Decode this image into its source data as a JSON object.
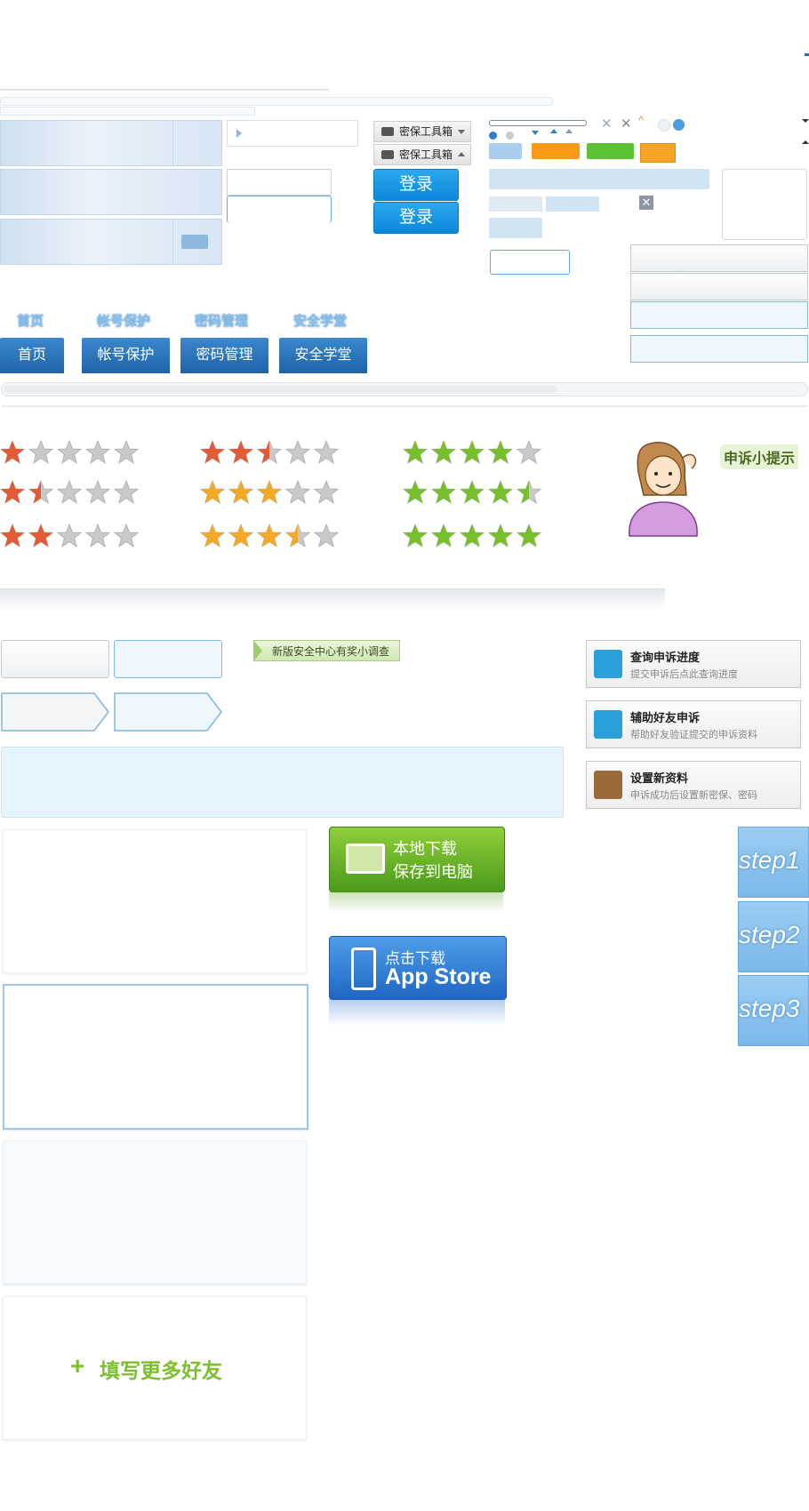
{
  "toolbox": {
    "label_a": "密保工具箱",
    "label_b": "密保工具箱"
  },
  "login": {
    "button_a": "登录",
    "button_b": "登录"
  },
  "nav": {
    "ghost": [
      "首页",
      "帐号保护",
      "密码管理",
      "安全学堂"
    ],
    "tabs": [
      "首页",
      "帐号保护",
      "密码管理",
      "安全学堂"
    ]
  },
  "ratings": {
    "colors": {
      "red": "#e35a35",
      "orange": "#f3a826",
      "green": "#77c02d",
      "empty": "#c9c9c9"
    },
    "groups": [
      {
        "color": "red",
        "rows": [
          1,
          1.5,
          2
        ]
      },
      {
        "color": "mixed",
        "rows": [
          2.5,
          3,
          3.5
        ]
      },
      {
        "color": "green",
        "rows": [
          4,
          4.5,
          5
        ]
      }
    ]
  },
  "tip": {
    "label": "申诉小提示"
  },
  "survey": {
    "label": "新版安全中心有奖小调查"
  },
  "cards": [
    {
      "title": "查询申诉进度",
      "subtitle": "提交申诉后点此查询进度",
      "icon": "progress-icon",
      "color": "#2a9fd8"
    },
    {
      "title": "辅助好友申诉",
      "subtitle": "帮助好友验证提交的申诉资料",
      "icon": "smile-icon",
      "color": "#2a9fd8"
    },
    {
      "title": "设置新资料",
      "subtitle": "申诉成功后设置新密保、密码",
      "icon": "notepad-icon",
      "color": "#9a6a3a"
    }
  ],
  "download": {
    "local_line1": "本地下载",
    "local_line2": "保存到电脑",
    "app_line1": "点击下载",
    "app_line2": "App Store"
  },
  "steps": [
    "step1",
    "step2",
    "step3"
  ],
  "more_friends": {
    "label": "填写更多好友"
  },
  "theme": {
    "accent": "#0b88d8",
    "nav": "#1e63a8",
    "green": "#7dc02d"
  }
}
